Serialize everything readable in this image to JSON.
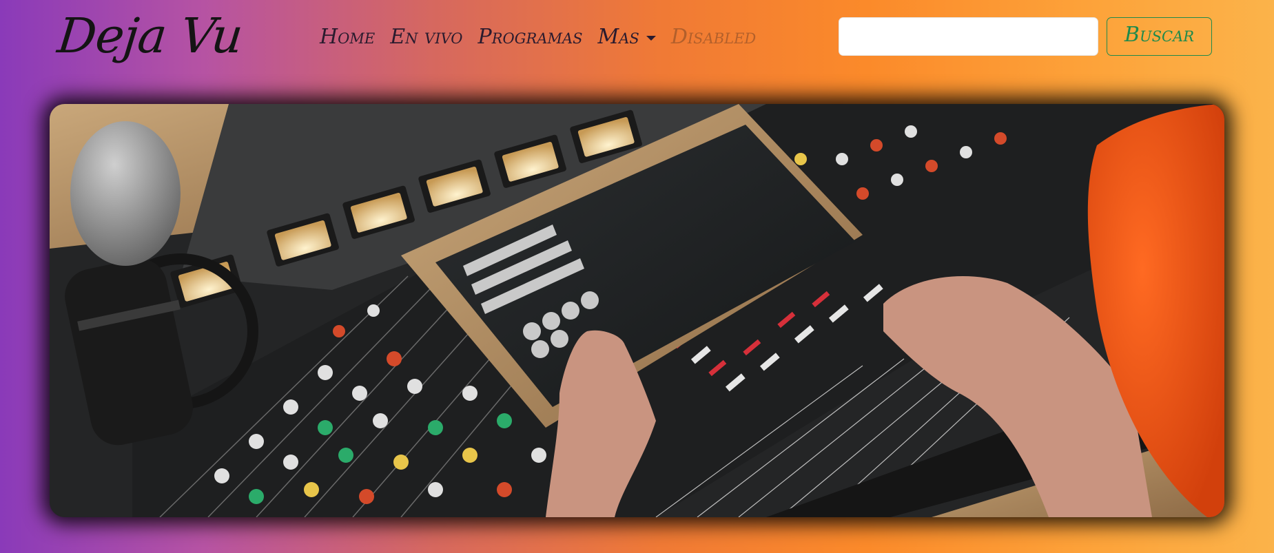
{
  "navbar": {
    "brand": "Deja Vu",
    "items": [
      {
        "label": "Home",
        "disabled": false
      },
      {
        "label": "En vivo",
        "disabled": false
      },
      {
        "label": "Programas",
        "disabled": false
      },
      {
        "label": "Mas",
        "disabled": false,
        "dropdown": true
      },
      {
        "label": "Disabled",
        "disabled": true
      }
    ]
  },
  "search": {
    "placeholder": "",
    "value": "",
    "button_label": "Buscar"
  },
  "hero": {
    "image": "radio-studio-mixing-console-photo"
  },
  "colors": {
    "gradient_start": "#8a3ab9",
    "gradient_mid": "#fb8a2a",
    "gradient_end": "#fbb34a",
    "button_accent": "#1e8a4c",
    "text_dark": "#141414"
  }
}
